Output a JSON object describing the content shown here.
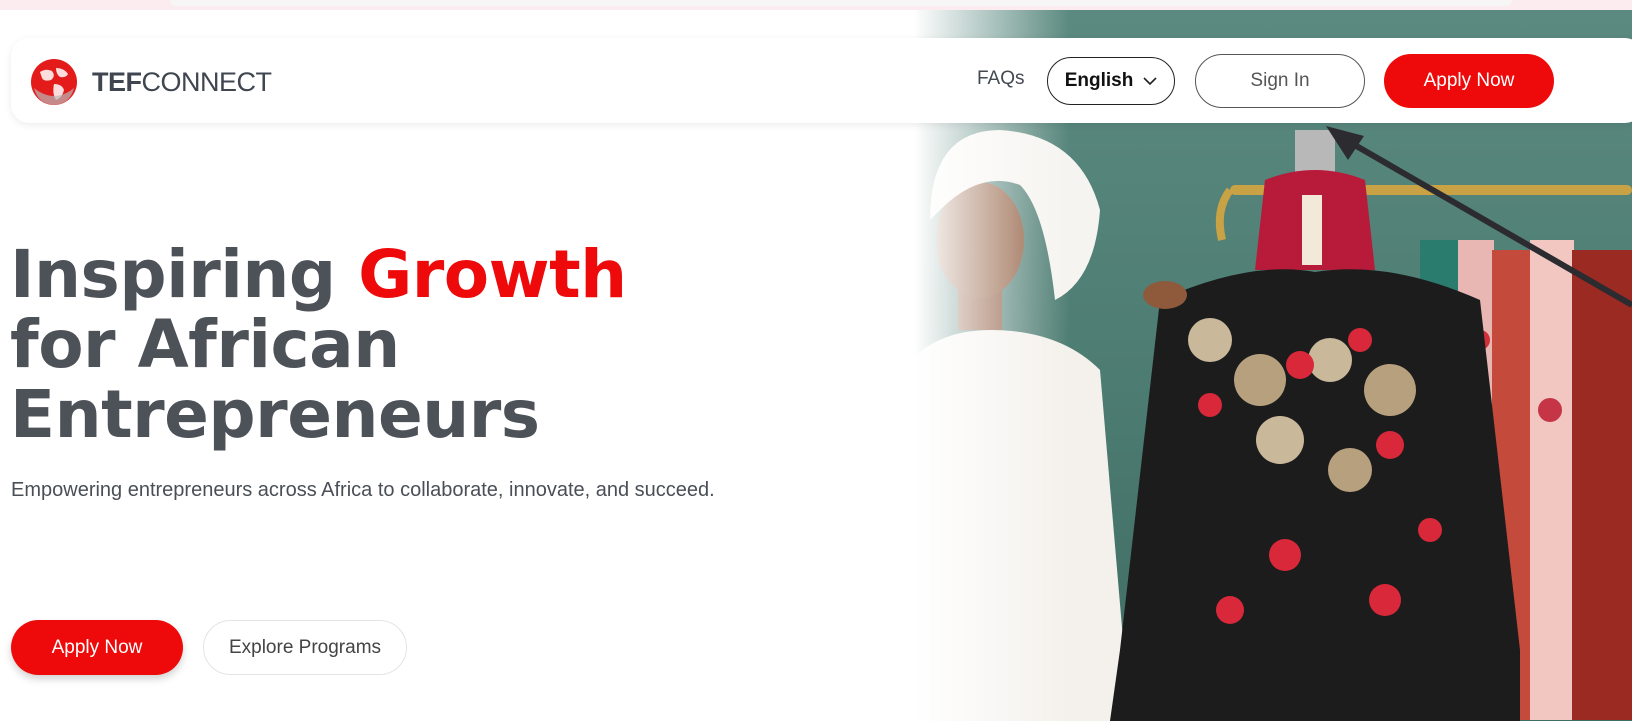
{
  "header": {
    "logo_bold": "TEF",
    "logo_regular": "CONNECT",
    "faq_label": "FAQs",
    "language_selected": "English",
    "sign_in_label": "Sign In",
    "apply_label": "Apply Now"
  },
  "hero": {
    "headline_part1": "Inspiring ",
    "headline_accent": "Growth",
    "headline_line2": "for African",
    "headline_line3": "Entrepreneurs",
    "subtitle": "Empowering entrepreneurs across Africa to collaborate, innovate, and succeed.",
    "primary_button": "Apply Now",
    "secondary_button": "Explore Programs"
  },
  "colors": {
    "brand_red": "#ee0a0a",
    "text_gray": "#4d5158"
  },
  "icons": {
    "logo": "globe-icon",
    "dropdown": "chevron-down-icon",
    "annotation": "arrow-pointer"
  }
}
